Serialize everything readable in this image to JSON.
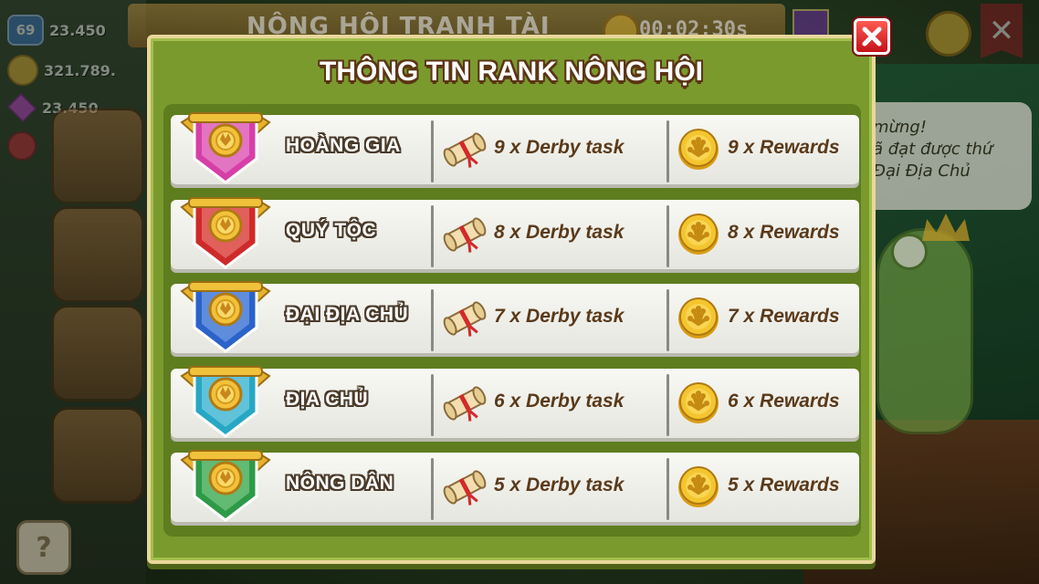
{
  "background": {
    "hud": {
      "level": "69",
      "stat_1": "23.450",
      "coins": "321.789.",
      "gems": "23.450"
    },
    "event_title": "NÔNG HỘI TRANH TÀI",
    "timer": "00:02:30s",
    "speech_bubble": [
      "mừng!",
      "ã đạt được thứ",
      "Đại Địa Chủ"
    ],
    "help_label": "?"
  },
  "modal": {
    "title": "THÔNG TIN RANK NÔNG HỘI",
    "close_symbol": "✕",
    "ranks": [
      {
        "name": "HOÀNG GIA",
        "tasks": "9 x Derby task",
        "rewards": "9 x Rewards",
        "color": "#d63fa8",
        "accent": "#f4b6e1"
      },
      {
        "name": "QUÝ TỘC",
        "tasks": "8 x Derby task",
        "rewards": "8 x Rewards",
        "color": "#cf2a2a",
        "accent": "#f5a19a"
      },
      {
        "name": "ĐẠI ĐỊA CHỦ",
        "tasks": "7 x Derby task",
        "rewards": "7 x Rewards",
        "color": "#2a63c9",
        "accent": "#9fc1f5"
      },
      {
        "name": "ĐỊA CHỦ",
        "tasks": "6 x Derby task",
        "rewards": "6 x Rewards",
        "color": "#27a7c4",
        "accent": "#a6e6f3"
      },
      {
        "name": "NÔNG DÂN",
        "tasks": "5 x Derby task",
        "rewards": "5 x Rewards",
        "color": "#2d9a47",
        "accent": "#a4e3a9"
      }
    ]
  },
  "colors": {
    "modal_green": "#7a9a2e",
    "panel_green": "#5e7d1f",
    "text_brown": "#5a3a1a",
    "coin_gold": "#f0bf2a",
    "close_red": "#d8161f"
  }
}
